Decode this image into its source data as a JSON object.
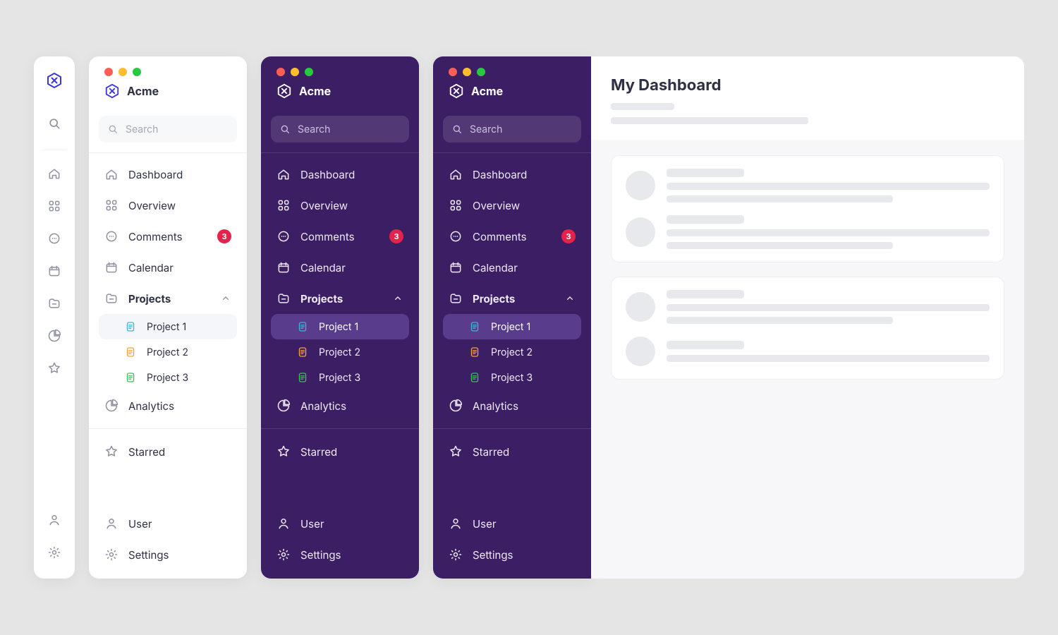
{
  "colors": {
    "accent": "#3a36e0",
    "purple": "#3b1e64",
    "red": "#e5234a",
    "orange": "#f3a33c",
    "green": "#34c759",
    "cyan": "#3db4d9",
    "leaf": "#3fbf5d"
  },
  "brand": {
    "name": "Acme",
    "logo": "hex-x-logo"
  },
  "traffic_lights": [
    "close",
    "minimize",
    "maximize"
  ],
  "search": {
    "placeholder": "Search"
  },
  "nav": {
    "items": [
      {
        "id": "dashboard",
        "label": "Dashboard",
        "icon": "home-icon"
      },
      {
        "id": "overview",
        "label": "Overview",
        "icon": "grid-icon"
      },
      {
        "id": "comments",
        "label": "Comments",
        "icon": "chat-icon",
        "badge": "3"
      },
      {
        "id": "calendar",
        "label": "Calendar",
        "icon": "calendar-icon"
      },
      {
        "id": "projects",
        "label": "Projects",
        "icon": "folder-icon",
        "expanded": true,
        "children": [
          {
            "id": "p1",
            "label": "Project 1",
            "icon": "file-icon",
            "color": "cyan",
            "selected": true
          },
          {
            "id": "p2",
            "label": "Project 2",
            "icon": "file-icon",
            "color": "orange"
          },
          {
            "id": "p3",
            "label": "Project 3",
            "icon": "file-icon",
            "color": "leaf"
          }
        ]
      },
      {
        "id": "analytics",
        "label": "Analytics",
        "icon": "pie-icon"
      }
    ],
    "secondary": [
      {
        "id": "starred",
        "label": "Starred",
        "icon": "star-icon"
      }
    ],
    "footer": [
      {
        "id": "user",
        "label": "User",
        "icon": "user-icon"
      },
      {
        "id": "settings",
        "label": "Settings",
        "icon": "gear-icon"
      }
    ]
  },
  "rail": {
    "icons": [
      "home-icon",
      "grid-icon",
      "chat-icon",
      "calendar-icon",
      "folder-icon",
      "pie-icon",
      "star-icon"
    ],
    "footer": [
      "user-icon",
      "gear-icon"
    ]
  },
  "content": {
    "title": "My Dashboard"
  }
}
